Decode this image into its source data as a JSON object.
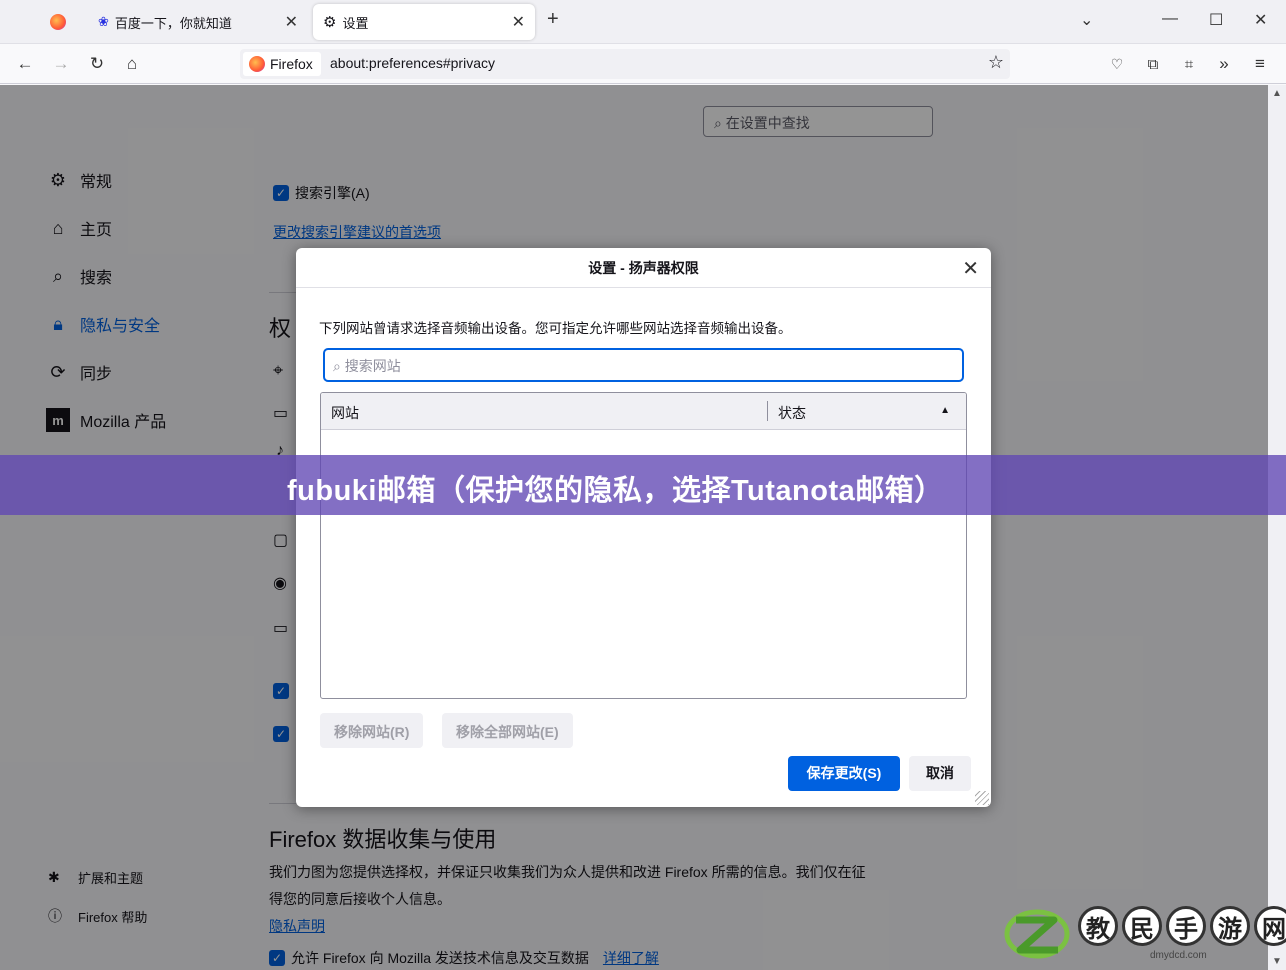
{
  "tabs": [
    {
      "label": ""
    },
    {
      "label": "百度一下，你就知道"
    },
    {
      "label": "设置"
    }
  ],
  "navbar": {
    "identity_label": "Firefox",
    "url": "about:preferences#privacy"
  },
  "settings": {
    "search_placeholder": "在设置中查找",
    "sidebar": [
      {
        "label": "常规",
        "icon": "gear-icon"
      },
      {
        "label": "主页",
        "icon": "home-icon"
      },
      {
        "label": "搜索",
        "icon": "search-icon"
      },
      {
        "label": "隐私与安全",
        "icon": "lock-icon"
      },
      {
        "label": "同步",
        "icon": "sync-icon"
      },
      {
        "label": "Mozilla 产品",
        "icon": "mozilla-icon"
      }
    ],
    "sidebar_footer": [
      {
        "label": "扩展和主题",
        "icon": "puzzle-icon"
      },
      {
        "label": "Firefox 帮助",
        "icon": "help-icon"
      }
    ],
    "search_engine_checkbox": "搜索引擎(A)",
    "change_search_link": "更改搜索引擎建议的首选项",
    "permissions_heading_partial": "权",
    "data_collection_heading": "Firefox 数据收集与使用",
    "data_collection_desc_1": "我们力图为您提供选择权，并保证只收集我们为众人提供和改进 Firefox 所需的信息。我们仅在征",
    "data_collection_desc_2": "得您的同意后接收个人信息。",
    "privacy_link": "隐私声明",
    "allow_technical_data": "允许 Firefox 向 Mozilla 发送技术信息及交互数据",
    "learn_more_link": "详细了解"
  },
  "dialog": {
    "title": "设置 - 扬声器权限",
    "description": "下列网站曾请求选择音频输出设备。您可指定允许哪些网站选择音频输出设备。",
    "search_placeholder": "搜索网站",
    "columns": [
      "网站",
      "状态"
    ],
    "remove_site": "移除网站(R)",
    "remove_all": "移除全部网站(E)",
    "save": "保存更改(S)",
    "cancel": "取消"
  },
  "banner": {
    "text": "fubuki邮箱（保护您的隐私，选择Tutanota邮箱）"
  },
  "watermark": {
    "chars": [
      "教",
      "民",
      "手",
      "游",
      "网"
    ],
    "url": "dmydcd.com"
  }
}
